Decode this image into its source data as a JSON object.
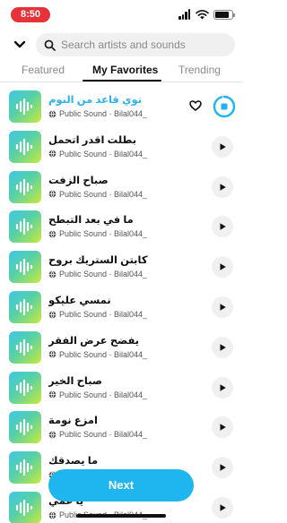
{
  "status": {
    "time": "8:50",
    "time_color": "#e6333a"
  },
  "search": {
    "placeholder": "Search artists and sounds"
  },
  "tabs": [
    {
      "label": "Featured",
      "active": false
    },
    {
      "label": "My Favorites",
      "active": true
    },
    {
      "label": "Trending",
      "active": false
    }
  ],
  "sounds": [
    {
      "title": "توي قاعد من النوم",
      "meta": "Public Sound · Bilal044_",
      "playing": true,
      "favorited": true,
      "progress": 0.95
    },
    {
      "title": "بطلت اقدر اتحمل",
      "meta": "Public Sound · Bilal044_"
    },
    {
      "title": "صباح الزفت",
      "meta": "Public Sound · Bilal044_"
    },
    {
      "title": "ما في بعد التبطح",
      "meta": "Public Sound · Bilal044_"
    },
    {
      "title": "كابتن الستريك بروح",
      "meta": "Public Sound · Bilal044_"
    },
    {
      "title": "نمسي عليكو",
      "meta": "Public Sound · Bilal044_"
    },
    {
      "title": "يفضح عرض الفقر",
      "meta": "Public Sound · Bilal044_"
    },
    {
      "title": "صباح الخير",
      "meta": "Public Sound · Bilal044_"
    },
    {
      "title": "امزع نومة",
      "meta": "Public Sound · Bilal044_"
    },
    {
      "title": "ما يصدقك",
      "meta": "Public Sound · Bilal044_"
    },
    {
      "title": "يا عمي",
      "meta": "Public Sound · Bilal044_"
    }
  ],
  "next_button": {
    "label": "Next"
  },
  "colors": {
    "accent": "#1fb6f0",
    "playing_title": "#2cb3e8",
    "thumb_gradient": [
      "#3fc7e8",
      "#57d0a6",
      "#c7ea3c"
    ]
  },
  "icons": {
    "back": "chevron-down-icon",
    "search": "search-icon",
    "waveform": "waveform-icon",
    "globe": "globe-icon",
    "play": "play-icon",
    "heart": "heart-icon"
  }
}
